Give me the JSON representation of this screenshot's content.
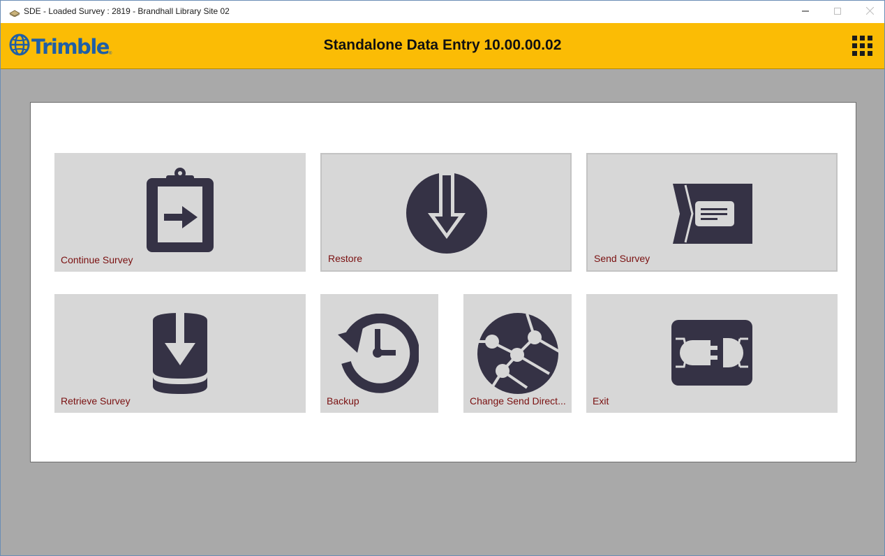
{
  "window": {
    "title": "SDE - Loaded Survey : 2819 - Brandhall Library Site 02",
    "app_icon": "stack-icon",
    "controls": {
      "minimize": "minimize-icon",
      "maximize": "maximize-icon",
      "close": "close-icon"
    }
  },
  "header": {
    "logo_text": "Trimble",
    "logo_trademark": "®",
    "title": "Standalone Data Entry 10.00.00.02",
    "menu_icon": "grid-menu-icon",
    "background_color": "#fbbc05"
  },
  "tiles": [
    {
      "label": "Continue Survey",
      "icon": "clipboard-arrow-icon"
    },
    {
      "label": "Restore",
      "icon": "download-circle-icon"
    },
    {
      "label": "Send Survey",
      "icon": "send-envelope-icon"
    },
    {
      "label": "Retrieve Survey",
      "icon": "database-download-icon"
    },
    {
      "label": "Backup",
      "icon": "history-clock-icon"
    },
    {
      "label": "Change Send Direct...",
      "icon": "network-globe-icon"
    },
    {
      "label": "Exit",
      "icon": "plug-icon"
    }
  ],
  "colors": {
    "tile_background": "#d7d7d7",
    "icon": "#353245",
    "label": "#7a1010",
    "backdrop": "#a9a9a9"
  }
}
